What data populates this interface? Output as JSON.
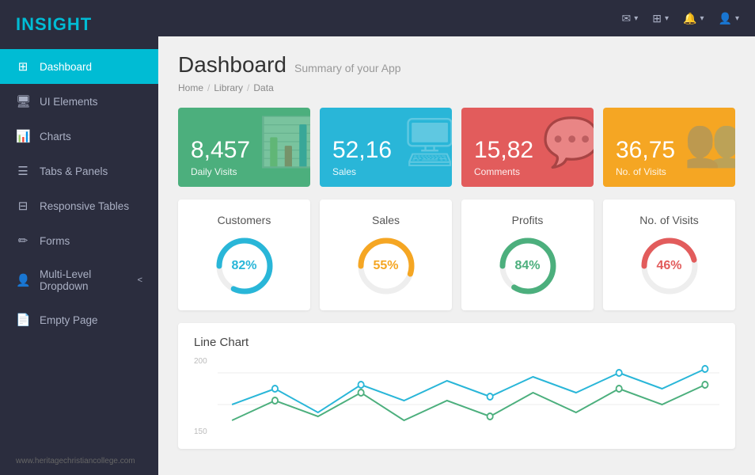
{
  "app": {
    "logo_highlight": "IN",
    "logo_rest": "SIGHT"
  },
  "sidebar": {
    "items": [
      {
        "id": "dashboard",
        "label": "Dashboard",
        "icon": "⊞",
        "active": true
      },
      {
        "id": "ui-elements",
        "label": "UI Elements",
        "icon": "🖥",
        "active": false
      },
      {
        "id": "charts",
        "label": "Charts",
        "icon": "📊",
        "active": false
      },
      {
        "id": "tabs-panels",
        "label": "Tabs & Panels",
        "icon": "☰",
        "active": false
      },
      {
        "id": "responsive-tables",
        "label": "Responsive Tables",
        "icon": "⊟",
        "active": false
      },
      {
        "id": "forms",
        "label": "Forms",
        "icon": "✏",
        "active": false
      },
      {
        "id": "multi-level-dropdown",
        "label": "Multi-Level Dropdown",
        "icon": "👤",
        "arrow": "<",
        "active": false
      },
      {
        "id": "empty-page",
        "label": "Empty Page",
        "icon": "📄",
        "active": false
      }
    ],
    "footer": "www.heritagechristiancollege.com"
  },
  "topbar": {
    "icons": [
      "✉",
      "☰",
      "🔔",
      "👤"
    ]
  },
  "header": {
    "title": "Dashboard",
    "subtitle": "Summary of your App"
  },
  "breadcrumb": {
    "items": [
      "Home",
      "Library",
      "Data"
    ]
  },
  "stats": [
    {
      "value": "8,457",
      "label": "Daily Visits",
      "icon": "📊",
      "color_class": "stat-green"
    },
    {
      "value": "52,16",
      "label": "Sales",
      "icon": "🖥",
      "color_class": "stat-blue"
    },
    {
      "value": "15,82",
      "label": "Comments",
      "icon": "💬",
      "color_class": "stat-red"
    },
    {
      "value": "36,75",
      "label": "No. of Visits",
      "icon": "👥",
      "color_class": "stat-orange"
    }
  ],
  "donuts": [
    {
      "label": "Customers",
      "percent": 82,
      "color": "#29b6d8",
      "text_color": "#29b6d8"
    },
    {
      "label": "Sales",
      "percent": 55,
      "color": "#f5a623",
      "text_color": "#f5a623"
    },
    {
      "label": "Profits",
      "percent": 84,
      "color": "#4caf7d",
      "text_color": "#4caf7d"
    },
    {
      "label": "No. of Visits",
      "percent": 46,
      "color": "#e25c5c",
      "text_color": "#e25c5c"
    }
  ],
  "line_chart": {
    "title": "Line Chart",
    "y_labels": [
      "200",
      "150"
    ],
    "colors": [
      "#29b6d8",
      "#4caf7d",
      "#e25c5c"
    ]
  }
}
